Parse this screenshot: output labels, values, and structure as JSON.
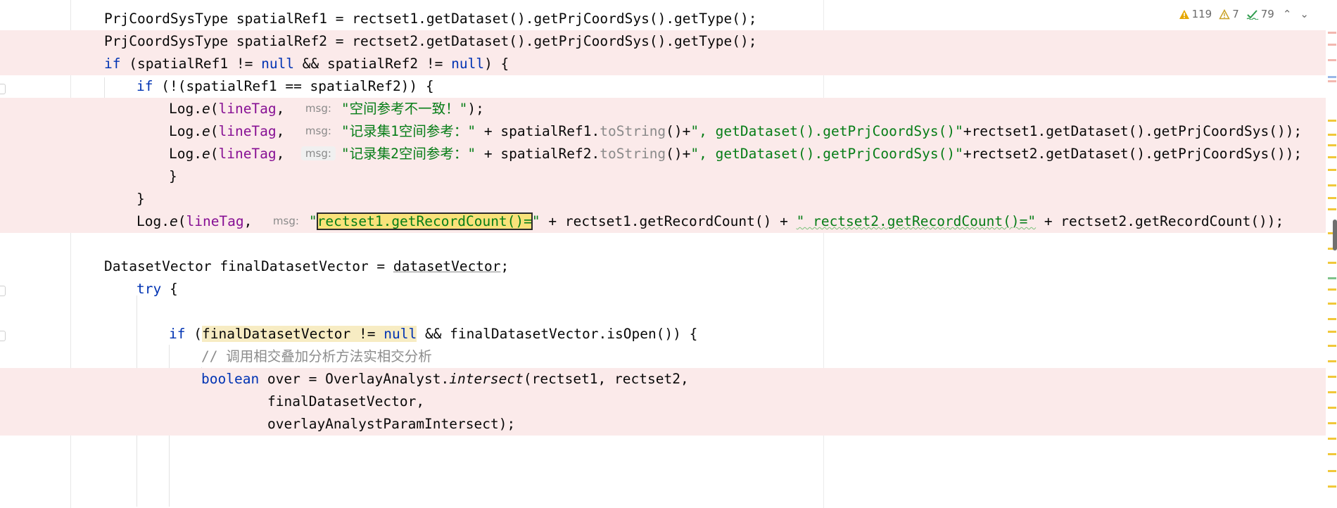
{
  "inspections": {
    "warnings": "119",
    "weak_warnings": "7",
    "typos": "79"
  },
  "hints": {
    "msg": "msg:"
  },
  "lines": {
    "l1": {
      "a": "PrjCoordSysType spatialRef1 = rectset1.getDataset().getPrjCoordSys().getType();"
    },
    "l2": {
      "a": "PrjCoordSysType spatialRef2 = rectset2.getDataset().getPrjCoordSys().getType();"
    },
    "l3": {
      "if": "if",
      "a": " (spatialRef1 != ",
      "null1": "null",
      "b": " && spatialRef2 != ",
      "null2": "null",
      "c": ") {"
    },
    "l4": {
      "if": "if",
      "a": " (!(spatialRef1 == spatialRef2)) {"
    },
    "l5": {
      "log": "Log.",
      "e": "e",
      "p": "(",
      "tag": "lineTag",
      "comma": ",",
      "str": "\"空间参考不一致！\"",
      "end": ");"
    },
    "l6": {
      "log": "Log.",
      "e": "e",
      "p": "(",
      "tag": "lineTag",
      "comma": ",",
      "str1": "\"记录集1空间参考：\"",
      "mid": " + spatialRef1.",
      "ts": "toString",
      "mid2": "()+",
      "str2": "\", getDataset().getPrjCoordSys()\"",
      "end": "+rectset1.getDataset().getPrjCoordSys());"
    },
    "l7": {
      "log": "Log.",
      "e": "e",
      "p": "(",
      "tag": "lineTag",
      "comma": ",",
      "str1": "\"记录集2空间参考：\"",
      "mid": " + spatialRef2.",
      "ts": "toString",
      "mid2": "()+",
      "str2": "\", getDataset().getPrjCoordSys()\"",
      "end": "+rectset2.getDataset().getPrjCoordSys());"
    },
    "l8": {
      "a": "}"
    },
    "l9": {
      "a": "}"
    },
    "l10": {
      "log": "Log.",
      "e": "e",
      "p": "(",
      "tag": "lineTag",
      "comma": ",",
      "q": "\"",
      "hit": "rectset1.getRecordCount()=",
      "q2": "\"",
      "mid": " + rectset1.getRecordCount() + ",
      "str2": "\" rectset2.getRecordCount()=\"",
      "end": " + rectset2.getRecordCount());"
    },
    "l12": {
      "a": "DatasetVector finalDatasetVector = ",
      "u": "datasetVector",
      "b": ";"
    },
    "l13": {
      "kw": "try",
      "a": " {"
    },
    "l15": {
      "if": "if",
      "a": " (",
      "hl": "finalDatasetVector != ",
      "null": "null",
      "b": " && finalDatasetVector.isOpen()) {"
    },
    "l16": {
      "a": "// 调用相交叠加分析方法实相交分析"
    },
    "l17": {
      "kw": "boolean",
      "a": " over = OverlayAnalyst.",
      "it": "intersect",
      "b": "(rectset1, rectset2,"
    },
    "l18": {
      "a": "finalDatasetVector,"
    },
    "l19": {
      "a": "overlayAnalystParamIntersect);"
    }
  },
  "colors": {
    "highlight_row": "#fbeaea",
    "keyword": "#0033b3",
    "string": "#067d17",
    "field": "#871094",
    "search_match": "#f9e27a",
    "warning": "#e6a700"
  }
}
